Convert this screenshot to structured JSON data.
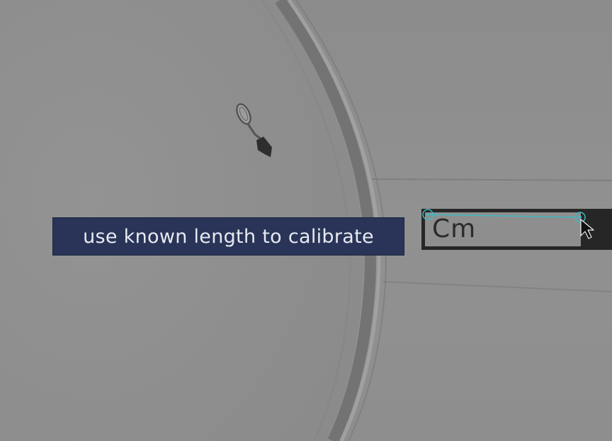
{
  "tooltip": {
    "text": "use known length to calibrate",
    "background_color": "#293458",
    "text_color": "#e8eaf1"
  },
  "scale_ruler": {
    "unit_label": "Cm"
  },
  "measure_tool": {
    "line_color": "#3fb8c0",
    "cursor": "pointer-arrow-icon"
  }
}
